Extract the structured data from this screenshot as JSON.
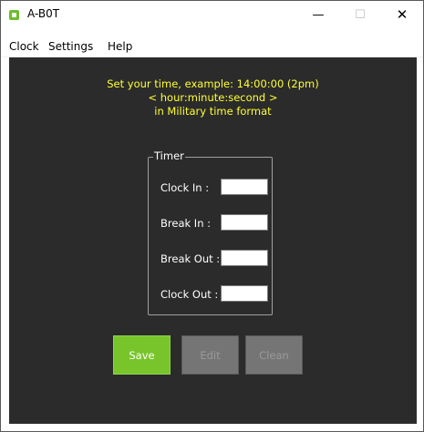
{
  "window": {
    "title": "A-B0T",
    "minimize_glyph": "—",
    "maximize_glyph": "☐",
    "close_glyph": "✕"
  },
  "menu": {
    "items": [
      {
        "label": "Clock"
      },
      {
        "label": "Settings"
      },
      {
        "label": "Help"
      }
    ]
  },
  "instructions": {
    "line1": "Set your time, example: 14:00:00 (2pm)",
    "line2": "< hour:minute:second >",
    "line3": "in Military time format",
    "color": "#ffff33"
  },
  "timer": {
    "title": "Timer",
    "fields": [
      {
        "label": "Clock In :",
        "value": ""
      },
      {
        "label": "Break In :",
        "value": ""
      },
      {
        "label": "Break Out :",
        "value": ""
      },
      {
        "label": "Clock Out :",
        "value": ""
      }
    ]
  },
  "buttons": {
    "save": "Save",
    "edit": "Edit",
    "clean": "Clean"
  },
  "colors": {
    "background": "#2b2b2b",
    "save_button": "#78c52b",
    "disabled_button": "#757575",
    "app_icon": "#6fbd2e"
  },
  "icons": {
    "app": "app-logo-icon"
  }
}
